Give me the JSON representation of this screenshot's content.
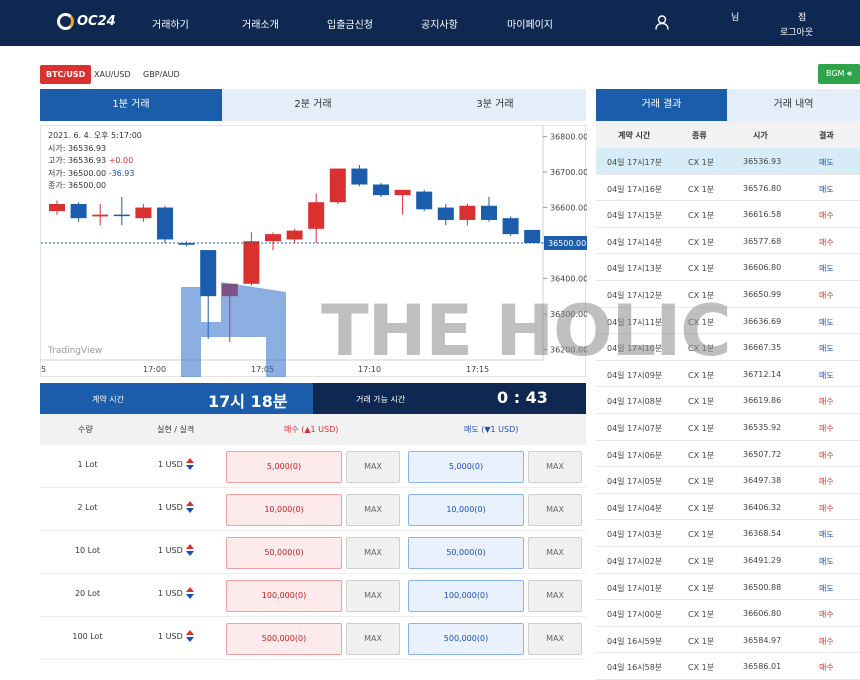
{
  "header": {
    "logo_text": "OC24",
    "nav": [
      "거래하기",
      "거래소개",
      "입출금신청",
      "공지사항",
      "마이페이지"
    ],
    "user_suffix": "님",
    "points_suffix": "점",
    "logout": "로그아웃"
  },
  "symbols": [
    "BTC/USD",
    "XAU/USD",
    "GBP/AUD"
  ],
  "bgm_label": "BGM",
  "trade_tabs": [
    "1분 거래",
    "2분 거래",
    "3분 거래"
  ],
  "chart_info": {
    "datetime": "2021. 6. 4. 오후 5:17:00",
    "open_label": "시가:",
    "open": "36536.93",
    "high_label": "고가:",
    "high": "36536.93",
    "high_change": "+0.00",
    "low_label": "저가:",
    "low": "36500.00",
    "low_change": "-36.93",
    "close_label": "종가:",
    "close": "36500.00"
  },
  "tradingview_label": "TradingView",
  "chart_data": {
    "type": "candlestick",
    "x_ticks": [
      "5",
      "17:00",
      "17:05",
      "17:10",
      "17:15"
    ],
    "y_ticks": [
      "36800.00",
      "36700.00",
      "36600.00",
      "36500.00",
      "36400.00",
      "36300.00",
      "36200.00"
    ],
    "ylim": [
      36170,
      36830
    ],
    "current_price": "36500.00",
    "candles": [
      {
        "o": 36590,
        "h": 36620,
        "l": 36580,
        "c": 36610
      },
      {
        "o": 36610,
        "h": 36615,
        "l": 36560,
        "c": 36570
      },
      {
        "o": 36575,
        "h": 36610,
        "l": 36550,
        "c": 36580
      },
      {
        "o": 36580,
        "h": 36630,
        "l": 36550,
        "c": 36578
      },
      {
        "o": 36570,
        "h": 36610,
        "l": 36560,
        "c": 36600
      },
      {
        "o": 36600,
        "h": 36605,
        "l": 36500,
        "c": 36510
      },
      {
        "o": 36500,
        "h": 36505,
        "l": 36490,
        "c": 36495
      },
      {
        "o": 36480,
        "h": 36480,
        "l": 36230,
        "c": 36350
      },
      {
        "o": 36350,
        "h": 36380,
        "l": 36220,
        "c": 36385
      },
      {
        "o": 36385,
        "h": 36530,
        "l": 36380,
        "c": 36505
      },
      {
        "o": 36505,
        "h": 36530,
        "l": 36480,
        "c": 36525
      },
      {
        "o": 36510,
        "h": 36540,
        "l": 36500,
        "c": 36535
      },
      {
        "o": 36540,
        "h": 36640,
        "l": 36500,
        "c": 36615
      },
      {
        "o": 36615,
        "h": 36710,
        "l": 36610,
        "c": 36710
      },
      {
        "o": 36710,
        "h": 36720,
        "l": 36660,
        "c": 36665
      },
      {
        "o": 36665,
        "h": 36670,
        "l": 36630,
        "c": 36635
      },
      {
        "o": 36635,
        "h": 36650,
        "l": 36580,
        "c": 36650
      },
      {
        "o": 36645,
        "h": 36650,
        "l": 36590,
        "c": 36595
      },
      {
        "o": 36600,
        "h": 36610,
        "l": 36550,
        "c": 36565
      },
      {
        "o": 36565,
        "h": 36610,
        "l": 36550,
        "c": 36605
      },
      {
        "o": 36605,
        "h": 36630,
        "l": 36560,
        "c": 36565
      },
      {
        "o": 36570,
        "h": 36575,
        "l": 36520,
        "c": 36525
      },
      {
        "o": 36536.93,
        "h": 36536.93,
        "l": 36500,
        "c": 36500
      }
    ]
  },
  "contract": {
    "time_label": "계약 시간",
    "time_value": "17시 18분",
    "remaining_label": "거래 가능 시간",
    "remaining_value": "0 : 43"
  },
  "order_table": {
    "headers": [
      "수량",
      "실현 / 실격",
      "매수 (▲1 USD)",
      "매도 (▼1 USD)"
    ],
    "rows": [
      {
        "lot": "1 Lot",
        "usd": "1 USD",
        "buy": "5,000(0)",
        "sell": "5,000(0)"
      },
      {
        "lot": "2 Lot",
        "usd": "1 USD",
        "buy": "10,000(0)",
        "sell": "10,000(0)"
      },
      {
        "lot": "10 Lot",
        "usd": "1 USD",
        "buy": "50,000(0)",
        "sell": "50,000(0)"
      },
      {
        "lot": "20 Lot",
        "usd": "1 USD",
        "buy": "100,000(0)",
        "sell": "100,000(0)"
      },
      {
        "lot": "100 Lot",
        "usd": "1 USD",
        "buy": "500,000(0)",
        "sell": "500,000(0)"
      }
    ],
    "max_label": "MAX"
  },
  "result_tabs": [
    "거래 결과",
    "거래 내역"
  ],
  "results_headers": [
    "계약 시간",
    "종류",
    "시가",
    "결과"
  ],
  "results": [
    {
      "time": "04일 17시17분",
      "type": "CX 1분",
      "price": "36536.93",
      "result": "매도"
    },
    {
      "time": "04일 17시16분",
      "type": "CX 1분",
      "price": "36576.80",
      "result": "매도"
    },
    {
      "time": "04일 17시15분",
      "type": "CX 1분",
      "price": "36616.58",
      "result": "매수"
    },
    {
      "time": "04일 17시14분",
      "type": "CX 1분",
      "price": "36577.68",
      "result": "매수"
    },
    {
      "time": "04일 17시13분",
      "type": "CX 1분",
      "price": "36606.80",
      "result": "매도"
    },
    {
      "time": "04일 17시12분",
      "type": "CX 1분",
      "price": "36650.99",
      "result": "매수"
    },
    {
      "time": "04일 17시11분",
      "type": "CX 1분",
      "price": "36636.69",
      "result": "매도"
    },
    {
      "time": "04일 17시10분",
      "type": "CX 1분",
      "price": "36667.35",
      "result": "매도"
    },
    {
      "time": "04일 17시09분",
      "type": "CX 1분",
      "price": "36712.14",
      "result": "매도"
    },
    {
      "time": "04일 17시08분",
      "type": "CX 1분",
      "price": "36619.86",
      "result": "매수"
    },
    {
      "time": "04일 17시07분",
      "type": "CX 1분",
      "price": "36535.92",
      "result": "매수"
    },
    {
      "time": "04일 17시06분",
      "type": "CX 1분",
      "price": "36507.72",
      "result": "매수"
    },
    {
      "time": "04일 17시05분",
      "type": "CX 1분",
      "price": "36497.38",
      "result": "매수"
    },
    {
      "time": "04일 17시04분",
      "type": "CX 1분",
      "price": "36406.32",
      "result": "매수"
    },
    {
      "time": "04일 17시03분",
      "type": "CX 1분",
      "price": "36368.54",
      "result": "매도"
    },
    {
      "time": "04일 17시02분",
      "type": "CX 1분",
      "price": "36491.29",
      "result": "매도"
    },
    {
      "time": "04일 17시01분",
      "type": "CX 1분",
      "price": "36500.88",
      "result": "매도"
    },
    {
      "time": "04일 17시00분",
      "type": "CX 1분",
      "price": "36606.80",
      "result": "매수"
    },
    {
      "time": "04일 16시59분",
      "type": "CX 1분",
      "price": "36584.97",
      "result": "매수"
    },
    {
      "time": "04일 16시58분",
      "type": "CX 1분",
      "price": "36586.01",
      "result": "매수"
    }
  ],
  "watermark": "THE HOLIC",
  "colors": {
    "navy": "#0f2851",
    "blue": "#1b5dab",
    "up": "#d93030",
    "down": "#1a4fb8",
    "bgm": "#2fa34a"
  }
}
